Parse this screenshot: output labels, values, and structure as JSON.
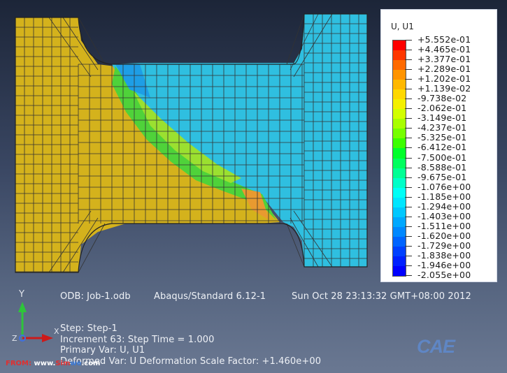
{
  "colors": {
    "left_region": "#d4b21c",
    "right_region": "#2fbfe0",
    "mesh_line": "#333333"
  },
  "legend": {
    "title": "U, U1",
    "labels": [
      "+5.552e-01",
      "+4.465e-01",
      "+3.377e-01",
      "+2.289e-01",
      "+1.202e-01",
      "+1.139e-02",
      "-9.738e-02",
      "-2.062e-01",
      "-3.149e-01",
      "-4.237e-01",
      "-5.325e-01",
      "-6.412e-01",
      "-7.500e-01",
      "-8.588e-01",
      "-9.675e-01",
      "-1.076e+00",
      "-1.185e+00",
      "-1.294e+00",
      "-1.403e+00",
      "-1.511e+00",
      "-1.620e+00",
      "-1.729e+00",
      "-1.838e+00",
      "-1.946e+00",
      "-2.055e+00"
    ],
    "colors": [
      "#ff0000",
      "#ff3700",
      "#ff6a00",
      "#ff9400",
      "#ffb800",
      "#ffd800",
      "#f4f000",
      "#d2ff00",
      "#a8ff00",
      "#76ff00",
      "#3cff00",
      "#00ff2a",
      "#00ff5e",
      "#00ff94",
      "#00ffc8",
      "#00fff6",
      "#00e6ff",
      "#00c8ff",
      "#00a8ff",
      "#0088ff",
      "#0064ff",
      "#0040ff",
      "#0020ff",
      "#0000ff"
    ]
  },
  "info": {
    "odb": "ODB: Job-1.odb",
    "solver": "Abaqus/Standard 6.12-1",
    "date": "Sun Oct 28 23:13:32 GMT+08:00 2012",
    "step": "Step: Step-1",
    "increment": "Increment     63: Step Time =      1.000",
    "primary": "Primary Var: U, U1",
    "deformed": "Deformed Var: U   Deformation Scale Factor: +1.460e+00"
  },
  "triad": {
    "y_label": "Y",
    "z_label": "Z",
    "x_label": "X"
  },
  "watermark": {
    "prefix": "FROM:",
    "www": "www.",
    "sim": "Sim",
    "we": "we",
    "com": ".com"
  },
  "logo": "CAE"
}
